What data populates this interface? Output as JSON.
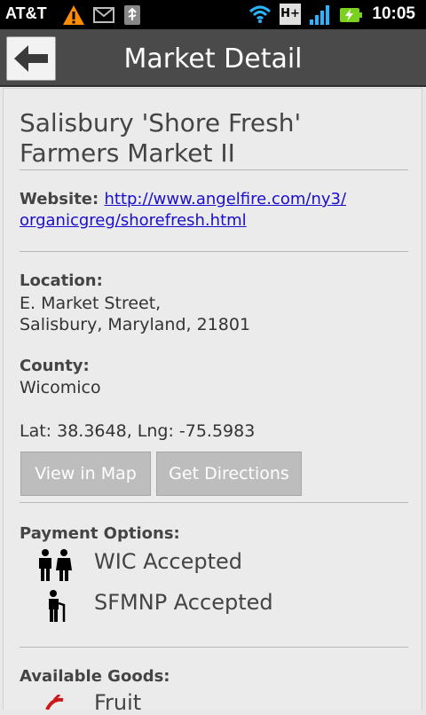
{
  "statusbar": {
    "carrier": "AT&T",
    "time": "10:05",
    "icons": [
      "warning-icon",
      "mail-icon",
      "usb-icon",
      "wifi-icon",
      "hplus-icon",
      "signal-icon",
      "battery-charging-icon"
    ],
    "network_label": "H+"
  },
  "header": {
    "title": "Market Detail",
    "back_icon": "arrow-left-icon"
  },
  "market": {
    "name_line1": "Salisbury 'Shore Fresh'",
    "name_line2": "Farmers Market II",
    "website_label": "Website:",
    "website_url_line1": "http://www.angelfire.com/ny3/",
    "website_url_line2": "organicgreg/shorefresh.html",
    "location_label": "Location:",
    "address_line1": "E. Market Street,",
    "address_line2": "Salisbury, Maryland, 21801",
    "county_label": "County:",
    "county": "Wicomico",
    "coordinates": "Lat: 38.3648, Lng: -75.5983"
  },
  "actions": {
    "view_map": "View in Map",
    "directions": "Get Directions"
  },
  "payment": {
    "label": "Payment Options:",
    "options": [
      {
        "label": "WIC Accepted",
        "icon": "wic-family-icon"
      },
      {
        "label": "SFMNP Accepted",
        "icon": "senior-icon"
      }
    ]
  },
  "goods": {
    "label": "Available Goods:",
    "items": [
      {
        "label": "Fruit",
        "icon": "fruit-icon"
      }
    ]
  },
  "colors": {
    "titlebar": "#4a4a4a",
    "link": "#1a0dcc",
    "button": "#bdbdbd",
    "statusbar": "#000000"
  }
}
